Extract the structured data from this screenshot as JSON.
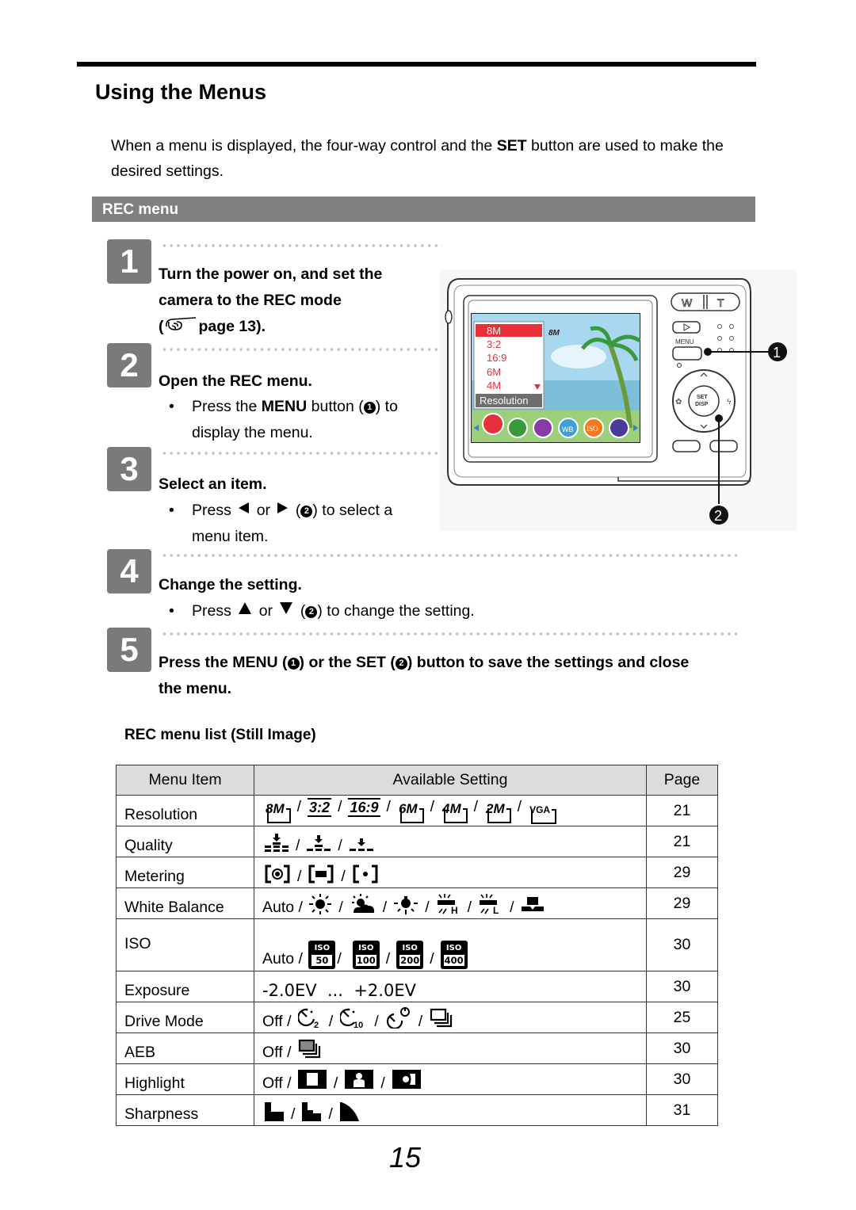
{
  "page": {
    "title": "Using the Menus",
    "intro_before": "When a menu is displayed, the four-way control and the ",
    "intro_bold": "SET",
    "intro_after": " button are used to make the desired settings.",
    "section_title": "REC menu",
    "page_number": "15"
  },
  "steps": [
    {
      "number": "1",
      "heading_line1": "Turn the power on, and set the",
      "heading_line2": "camera to the REC mode",
      "heading_ref_open": "(",
      "heading_ref": "page 13)."
    },
    {
      "number": "2",
      "heading": "Open the REC menu.",
      "bullet_before": "Press the ",
      "bullet_bold": "MENU",
      "bullet_mid": " button (",
      "bullet_marker": "1",
      "bullet_after": ") to",
      "bullet_line2": "display the menu."
    },
    {
      "number": "3",
      "heading": "Select an item.",
      "bullet_before": "Press",
      "bullet_or": "or",
      "bullet_marker": "2",
      "bullet_after": ") to select a",
      "bullet_line2": "menu item."
    },
    {
      "number": "4",
      "heading": "Change the setting.",
      "bullet_before": "Press",
      "bullet_or": "or",
      "bullet_marker": "2",
      "bullet_after": ") to change the setting."
    },
    {
      "number": "5",
      "heading_a": "Press the MENU (",
      "marker_1": "1",
      "heading_b": ") or the SET (",
      "marker_2": "2",
      "heading_c": ") button to save the settings and close",
      "heading_line2": "the menu."
    }
  ],
  "camera": {
    "zoom_w": "W",
    "zoom_t": "T",
    "menu_label": "MENU",
    "set_label": "SET",
    "disp_label": "DISP",
    "callout_1": "1",
    "callout_2": "2",
    "screen_badge": "8M",
    "screen_menu_items": [
      "8M",
      "3:2",
      "16:9",
      "6M",
      "4M"
    ],
    "screen_menu_selected": "8M",
    "screen_menu_caption": "Resolution",
    "screen_icons": [
      {
        "name": "resolution",
        "color": "#e8303a"
      },
      {
        "name": "quality",
        "color": "#3a9a3a"
      },
      {
        "name": "metering",
        "color": "#8a3aa8"
      },
      {
        "name": "white-balance",
        "color": "#3aa0d8",
        "text": "WB"
      },
      {
        "name": "iso",
        "color": "#f07a20",
        "text": "ISO"
      },
      {
        "name": "exposure",
        "color": "#4a3a9a"
      }
    ],
    "accent_red": "#e8303a"
  },
  "table": {
    "title": "REC menu list (Still Image)",
    "headers": [
      "Menu Item",
      "Available Setting",
      "Page"
    ],
    "rows": [
      {
        "item": "Resolution",
        "settings": [
          "8M",
          "3:2",
          "16:9",
          "6M",
          "4M",
          "2M",
          "VGA"
        ],
        "page": "21"
      },
      {
        "item": "Quality",
        "settings": [
          "fine",
          "standard",
          "economy"
        ],
        "page": "21"
      },
      {
        "item": "Metering",
        "settings": [
          "center-weighted",
          "average",
          "spot"
        ],
        "page": "29"
      },
      {
        "item": "White Balance",
        "prefix": "Auto /",
        "settings": [
          "daylight",
          "cloudy",
          "tungsten",
          "fluorescent-h",
          "fluorescent-l",
          "manual"
        ],
        "page": "29"
      },
      {
        "item": "ISO",
        "prefix": "Auto /",
        "settings": [
          "50",
          "100",
          "200",
          "400"
        ],
        "iso_label": "ISO",
        "page": "30"
      },
      {
        "item": "Exposure",
        "text": "-2.0EV  ...  +2.0EV",
        "page": "30"
      },
      {
        "item": "Drive Mode",
        "prefix": "Off /",
        "settings": [
          "self-timer-2s",
          "self-timer-10s",
          "double-timer",
          "continuous"
        ],
        "timer_2": "2",
        "timer_10": "10",
        "page": "25"
      },
      {
        "item": "AEB",
        "prefix": "Off /",
        "settings": [
          "aeb"
        ],
        "page": "30"
      },
      {
        "item": "Highlight",
        "prefix": "Off /",
        "settings": [
          "frame",
          "portrait",
          "off-center"
        ],
        "page": "30"
      },
      {
        "item": "Sharpness",
        "settings": [
          "sharp",
          "normal",
          "soft"
        ],
        "page": "31"
      }
    ]
  }
}
